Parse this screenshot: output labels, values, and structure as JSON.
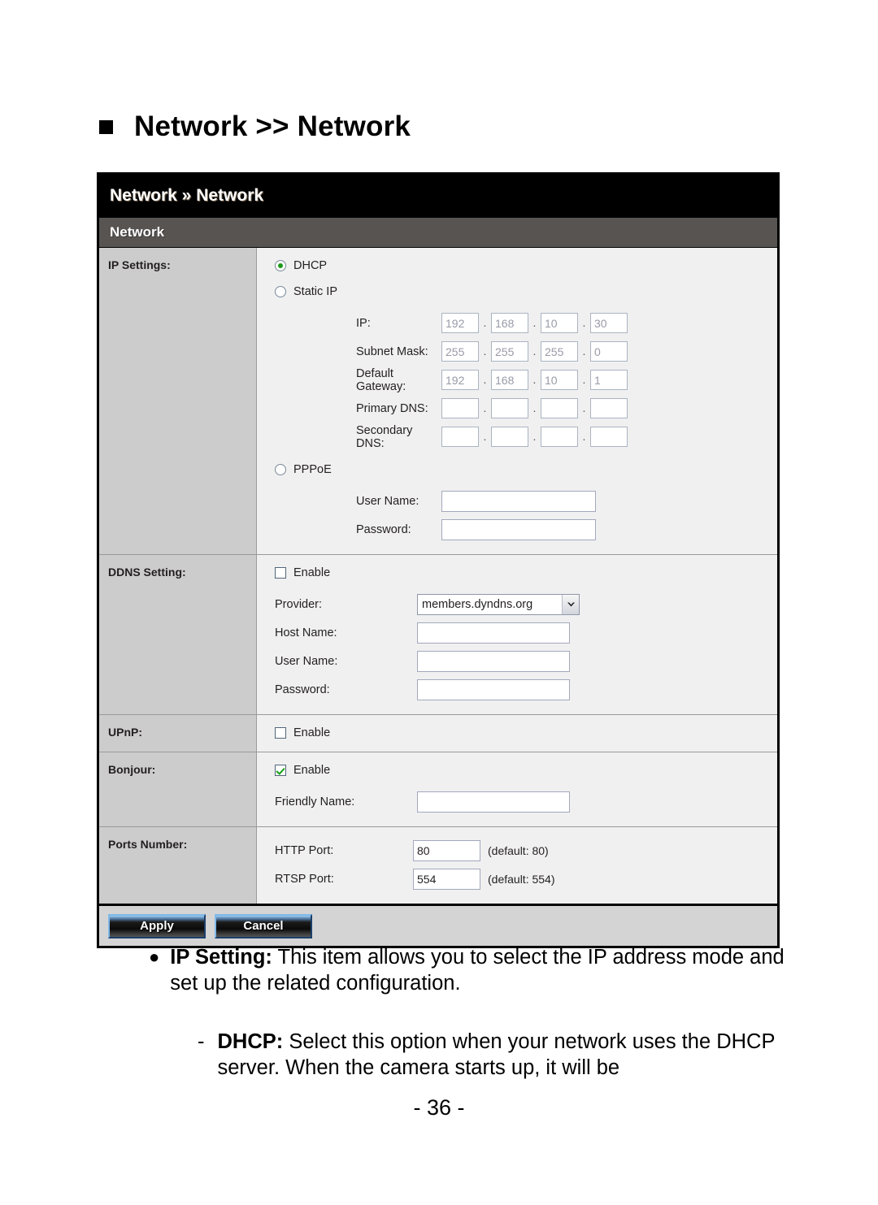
{
  "heading": {
    "text": "Network >> Network",
    "bullet": "square-bullet"
  },
  "panel": {
    "topbar_title": "Network » Network",
    "section_title": "Network",
    "rows": {
      "ip_settings": {
        "label": "IP Settings:",
        "options": [
          {
            "label": "DHCP",
            "selected": true
          },
          {
            "label": "Static IP",
            "selected": false
          },
          {
            "label": "PPPoE",
            "selected": false
          }
        ],
        "fields": [
          {
            "label": "IP:",
            "octets": [
              "192",
              "168",
              "10",
              "30"
            ]
          },
          {
            "label": "Subnet Mask:",
            "octets": [
              "255",
              "255",
              "255",
              "0"
            ]
          },
          {
            "label": "Default Gateway:",
            "octets": [
              "192",
              "168",
              "10",
              "1"
            ]
          },
          {
            "label": "Primary DNS:",
            "octets": [
              "",
              "",
              "",
              ""
            ]
          },
          {
            "label": "Secondary DNS:",
            "octets": [
              "",
              "",
              "",
              ""
            ]
          }
        ],
        "pppoe_fields": [
          {
            "label": "User Name:",
            "value": ""
          },
          {
            "label": "Password:",
            "value": ""
          }
        ]
      },
      "ddns": {
        "label": "DDNS Setting:",
        "enable_label": "Enable",
        "enabled": false,
        "provider_label": "Provider:",
        "provider_value": "members.dyndns.org",
        "fields": [
          {
            "label": "Host Name:",
            "value": ""
          },
          {
            "label": "User Name:",
            "value": ""
          },
          {
            "label": "Password:",
            "value": ""
          }
        ]
      },
      "upnp": {
        "label": "UPnP:",
        "enable_label": "Enable",
        "enabled": false
      },
      "bonjour": {
        "label": "Bonjour:",
        "enable_label": "Enable",
        "enabled": true,
        "friendly_name_label": "Friendly Name:",
        "friendly_name_value": ""
      },
      "ports": {
        "label": "Ports Number:",
        "http": {
          "label": "HTTP Port:",
          "value": "80",
          "hint": "(default: 80)"
        },
        "rtsp": {
          "label": "RTSP Port:",
          "value": "554",
          "hint": "(default: 554)"
        }
      }
    },
    "footer": {
      "apply_label": "Apply",
      "cancel_label": "Cancel"
    }
  },
  "copy": {
    "item1_bullet": "●",
    "item1_term": "IP Setting:",
    "item1_text": " This item allows you to select the IP address mode and set up the related configuration.",
    "item2_dash": "-",
    "item2_term": "DHCP:",
    "item2_text": " Select this option when your network uses the DHCP server. When the camera starts up, it will be"
  },
  "page_number": "- 36 -",
  "colors": {
    "topbar": "#000000",
    "section_bar": "#575452",
    "label_col": "#cccccc",
    "content_bg": "#f0f0f0",
    "footer_bg": "#d4d4d4",
    "check_green": "#12a012"
  }
}
